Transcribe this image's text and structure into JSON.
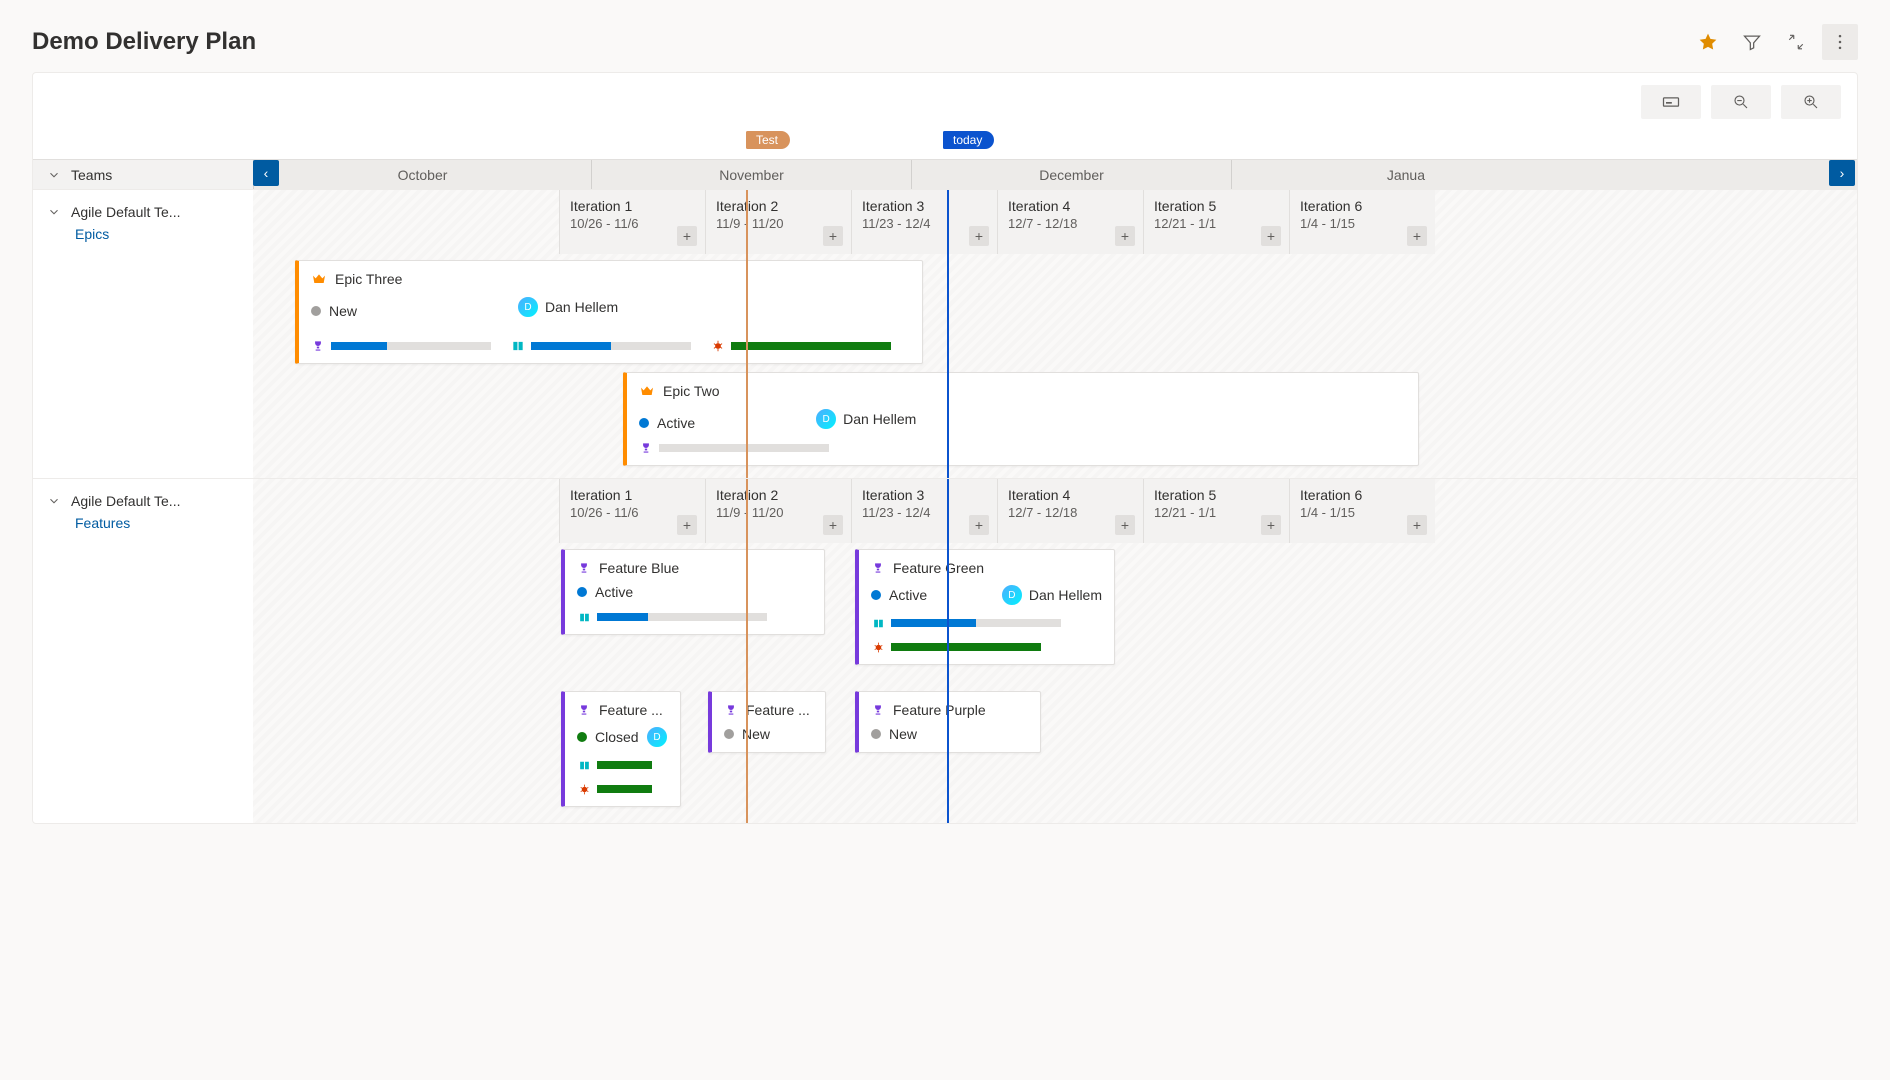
{
  "title": "Demo Delivery Plan",
  "markers": {
    "test": "Test",
    "today": "today"
  },
  "teams_label": "Teams",
  "months": [
    "October",
    "November",
    "December",
    "Janua"
  ],
  "iterations": [
    {
      "name": "Iteration 1",
      "dates": "10/26 - 11/6"
    },
    {
      "name": "Iteration 2",
      "dates": "11/9 - 11/20"
    },
    {
      "name": "Iteration 3",
      "dates": "11/23 - 12/4"
    },
    {
      "name": "Iteration 4",
      "dates": "12/7 - 12/18"
    },
    {
      "name": "Iteration 5",
      "dates": "12/21 - 1/1"
    },
    {
      "name": "Iteration 6",
      "dates": "1/4 - 1/15"
    }
  ],
  "sections": {
    "epics": {
      "team": "Agile Default Te...",
      "backlog": "Epics"
    },
    "features": {
      "team": "Agile Default Te...",
      "backlog": "Features"
    }
  },
  "cards": {
    "epic3": {
      "title": "Epic Three",
      "status": "New",
      "assignee": "Dan Hellem"
    },
    "epic2": {
      "title": "Epic Two",
      "status": "Active",
      "assignee": "Dan Hellem"
    },
    "fblue": {
      "title": "Feature Blue",
      "status": "Active"
    },
    "fgreen": {
      "title": "Feature Green",
      "status": "Active",
      "assignee": "Dan Hellem"
    },
    "fclosed": {
      "title": "Feature ...",
      "status": "Closed"
    },
    "fnew": {
      "title": "Feature ...",
      "status": "New"
    },
    "fpurple": {
      "title": "Feature Purple",
      "status": "New"
    }
  }
}
